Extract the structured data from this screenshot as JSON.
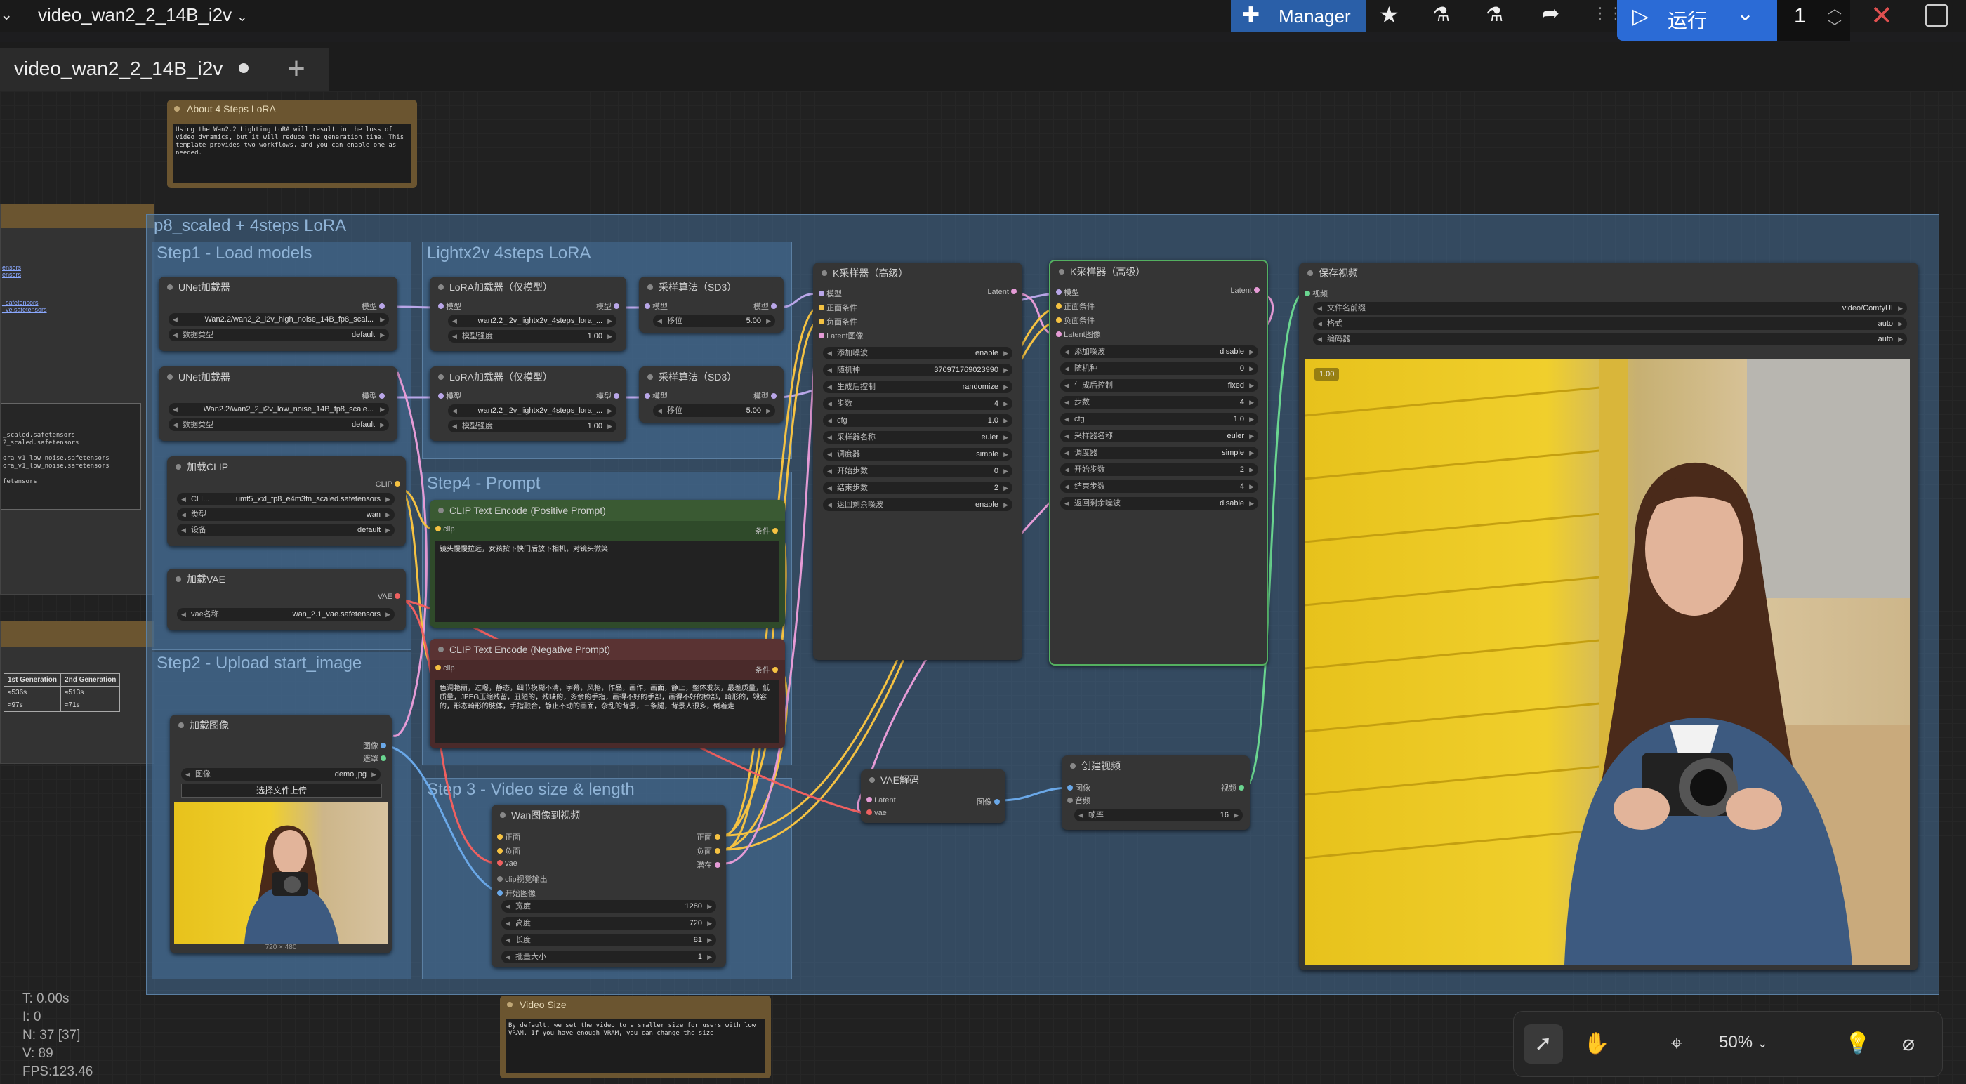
{
  "topbar": {
    "workflow_name": "video_wan2_2_14B_i2v",
    "manager_label": "Manager",
    "run_label": "运行",
    "queue_count": "1"
  },
  "tabs": [
    {
      "label": "video_wan2_2_14B_i2v"
    }
  ],
  "canvas": {
    "outer_group_title": "p8_scaled + 4steps LoRA",
    "step1_title": "Step1 - Load models",
    "lora_group_title": "Lightx2v 4steps LoRA",
    "step4_title": "Step4 - Prompt",
    "step2_title": "Step2 - Upload start_image",
    "step3_title": "Step 3 - Video size & length"
  },
  "left_panel": {
    "links": [
      "ensors",
      "ensors",
      "_safetensors",
      "_ve.safetensors"
    ],
    "files": [
      "_scaled.safetensors",
      "2_scaled.safetensors",
      "",
      "ora_v1_low_noise.safetensors",
      "ora_v1_low_noise.safetensors",
      "",
      "fetensors"
    ],
    "table_headers": [
      "1st Generation",
      "2nd Generation"
    ],
    "table_rows": [
      [
        "≈536s",
        "≈513s"
      ],
      [
        "≈97s",
        "≈71s"
      ]
    ]
  },
  "notes": {
    "about_title": "About 4 Steps LoRA",
    "about_text": "Using the Wan2.2 Lighting LoRA will result in the loss of video dynamics, but it will reduce the generation time. This template provides two workflows, and you can enable one as needed.",
    "size_title": "Video Size",
    "size_text": "By default, we set the video to a smaller size for users with low VRAM. If you have enough VRAM, you can change the size"
  },
  "nodes": {
    "unet1": {
      "title": "UNet加载器",
      "out": "模型",
      "w1_val": "Wan2.2/wan2_2_i2v_high_noise_14B_fp8_scal...",
      "w2_label": "数据类型",
      "w2_val": "default"
    },
    "unet2": {
      "title": "UNet加载器",
      "out": "模型",
      "w1_val": "Wan2.2/wan2_2_i2v_low_noise_14B_fp8_scale...",
      "w2_label": "数据类型",
      "w2_val": "default"
    },
    "clip": {
      "title": "加载CLIP",
      "out": "CLIP",
      "w1_label": "CLI...",
      "w1_val": "umt5_xxl_fp8_e4m3fn_scaled.safetensors",
      "w2_label": "类型",
      "w2_val": "wan",
      "w3_label": "设备",
      "w3_val": "default"
    },
    "vae": {
      "title": "加载VAE",
      "out": "VAE",
      "w1_label": "vae名称",
      "w1_val": "wan_2.1_vae.safetensors"
    },
    "lora1": {
      "title": "LoRA加载器（仅模型）",
      "in": "模型",
      "out": "模型",
      "w1_val": "wan2.2_i2v_lightx2v_4steps_lora_...",
      "w2_label": "模型强度",
      "w2_val": "1.00"
    },
    "lora2": {
      "title": "LoRA加载器（仅模型）",
      "in": "模型",
      "out": "模型",
      "w1_val": "wan2.2_i2v_lightx2v_4steps_lora_...",
      "w2_label": "模型强度",
      "w2_val": "1.00"
    },
    "sd3a": {
      "title": "采样算法（SD3）",
      "in": "模型",
      "out": "模型",
      "w1_label": "移位",
      "w1_val": "5.00"
    },
    "sd3b": {
      "title": "采样算法（SD3）",
      "in": "模型",
      "out": "模型",
      "w1_label": "移位",
      "w1_val": "5.00"
    },
    "pos": {
      "title": "CLIP Text Encode (Positive Prompt)",
      "in": "clip",
      "out": "条件",
      "text": "镜头慢慢拉远，女孩按下快门后放下相机，对镜头微笑"
    },
    "neg": {
      "title": "CLIP Text Encode (Negative Prompt)",
      "in": "clip",
      "out": "条件",
      "text": "色调艳丽，过曝，静态，细节模糊不清，字幕，风格，作品，画作，画面，静止，整体发灰，最差质量，低质量，JPEG压缩残留，丑陋的，残缺的，多余的手指，画得不好的手部，画得不好的脸部，畸形的，毁容的，形态畸形的肢体，手指融合，静止不动的画面，杂乱的背景，三条腿，背景人很多，倒着走"
    },
    "ks1": {
      "title": "K采样器（高级）",
      "inputs": [
        "模型",
        "正面条件",
        "负面条件",
        "Latent图像"
      ],
      "out": "Latent",
      "widgets": [
        [
          "添加噪波",
          "enable"
        ],
        [
          "随机种",
          "370971769023990"
        ],
        [
          "生成后控制",
          "randomize"
        ],
        [
          "步数",
          "4"
        ],
        [
          "cfg",
          "1.0"
        ],
        [
          "采样器名称",
          "euler"
        ],
        [
          "调度器",
          "simple"
        ],
        [
          "开始步数",
          "0"
        ],
        [
          "结束步数",
          "2"
        ],
        [
          "返回剩余噪波",
          "enable"
        ]
      ]
    },
    "ks2": {
      "title": "K采样器（高级）",
      "inputs": [
        "模型",
        "正面条件",
        "负面条件",
        "Latent图像"
      ],
      "out": "Latent",
      "widgets": [
        [
          "添加噪波",
          "disable"
        ],
        [
          "随机种",
          "0"
        ],
        [
          "生成后控制",
          "fixed"
        ],
        [
          "步数",
          "4"
        ],
        [
          "cfg",
          "1.0"
        ],
        [
          "采样器名称",
          "euler"
        ],
        [
          "调度器",
          "simple"
        ],
        [
          "开始步数",
          "2"
        ],
        [
          "结束步数",
          "4"
        ],
        [
          "返回剩余噪波",
          "disable"
        ]
      ]
    },
    "save": {
      "title": "保存视频",
      "in": "视频",
      "widgets": [
        [
          "文件名前缀",
          "video/ComfyUI"
        ],
        [
          "格式",
          "auto"
        ],
        [
          "编码器",
          "auto"
        ]
      ],
      "badge": "1.00"
    },
    "loadimg": {
      "title": "加载图像",
      "out1": "图像",
      "out2": "遮罩",
      "w1_label": "图像",
      "w1_val": "demo.jpg",
      "upload": "选择文件上传",
      "size": "720 × 480"
    },
    "wan": {
      "title": "Wan图像到视频",
      "inputs": [
        "正面",
        "负面",
        "vae",
        "clip视觉输出",
        "开始图像"
      ],
      "outputs": [
        "正面",
        "负面",
        "潜在"
      ],
      "widgets": [
        [
          "宽度",
          "1280"
        ],
        [
          "高度",
          "720"
        ],
        [
          "长度",
          "81"
        ],
        [
          "批量大小",
          "1"
        ]
      ]
    },
    "vaedec": {
      "title": "VAE解码",
      "in1": "Latent",
      "in2": "vae",
      "out": "图像"
    },
    "mkvideo": {
      "title": "创建视频",
      "in1": "图像",
      "in2": "音频",
      "out": "视频",
      "w1_label": "帧率",
      "w1_val": "16"
    }
  },
  "stats": {
    "t": "T: 0.00s",
    "i": "I: 0",
    "n": "N: 37 [37]",
    "v": "V: 89",
    "fps": "FPS:123.46"
  },
  "toolbar": {
    "zoom": "50%"
  },
  "colors": {
    "accent_blue": "#2a5fa8",
    "group": "#4a6e96",
    "note": "#6b5530",
    "positive": "#2f4a2a",
    "negative": "#4a2a2a",
    "link_yellow": "#f5c242",
    "link_pink": "#e59bd6",
    "link_blue": "#6aa8e8"
  }
}
